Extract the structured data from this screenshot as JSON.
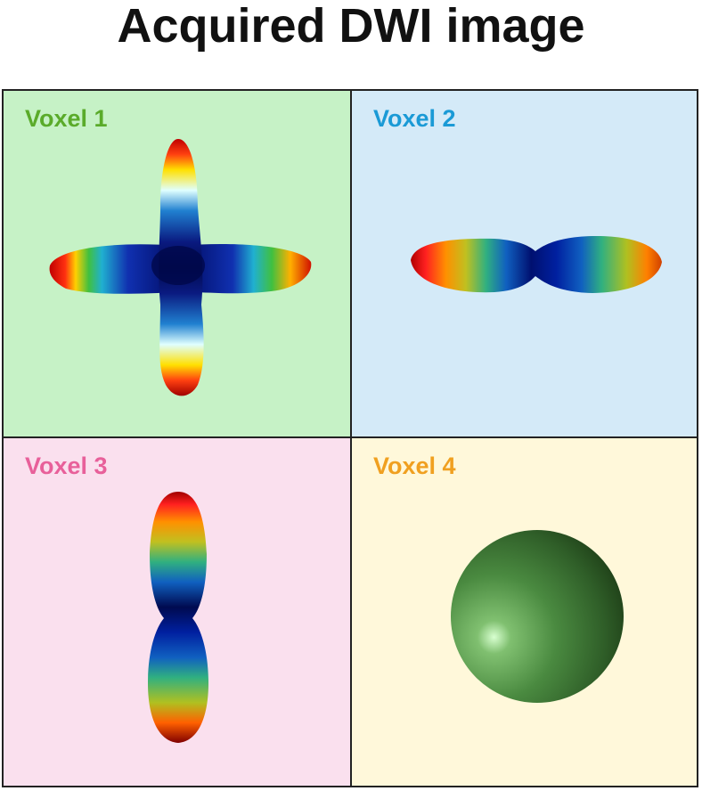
{
  "title": "Acquired DWI image",
  "voxels": [
    {
      "label": "Voxel 1",
      "label_color": "#5aab2a",
      "bg": "#c6f2c6",
      "glyph": "crossing-fibers-odf-icon"
    },
    {
      "label": "Voxel 2",
      "label_color": "#1a9ad6",
      "bg": "#d4eaf8",
      "glyph": "horizontal-fiber-odf-icon"
    },
    {
      "label": "Voxel 3",
      "label_color": "#e8609a",
      "bg": "#fae0ee",
      "glyph": "vertical-fiber-odf-icon"
    },
    {
      "label": "Voxel 4",
      "label_color": "#f0a020",
      "bg": "#fff8da",
      "glyph": "isotropic-sphere-icon"
    }
  ]
}
